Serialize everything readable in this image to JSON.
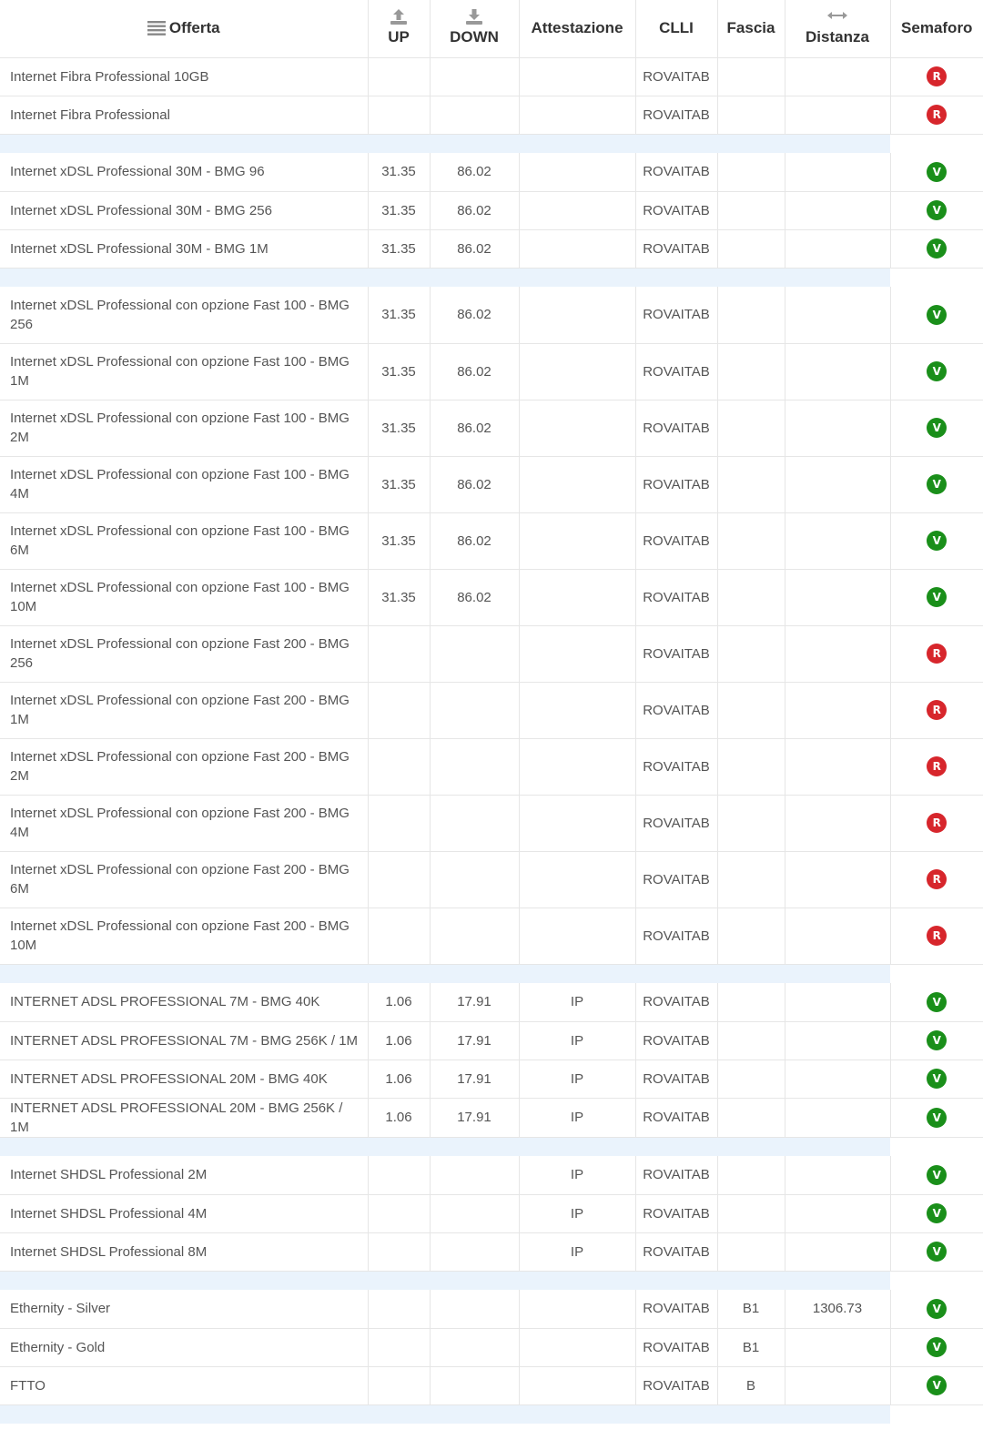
{
  "header": {
    "offerta": "Offerta",
    "up": "UP",
    "down": "DOWN",
    "attestazione": "Attestazione",
    "clli": "CLLI",
    "fascia": "Fascia",
    "distanza": "Distanza",
    "semaforo": "Semaforo",
    "icons": {
      "offerta": "list-icon",
      "up": "upload-icon",
      "down": "download-icon",
      "distanza": "horizontal-arrows-icon"
    }
  },
  "colors": {
    "red": "#d7262c",
    "green": "#1a8f1a",
    "separator": "#eaf3fc",
    "border": "#e6e6e6"
  },
  "rows": [
    {
      "offerta": "Internet Fibra Professional 10GB",
      "up": "",
      "down": "",
      "attestazione": "",
      "clli": "ROVAITAB",
      "fascia": "",
      "distanza": "",
      "semaforo": "R"
    },
    {
      "offerta": "Internet Fibra Professional",
      "up": "",
      "down": "",
      "attestazione": "",
      "clli": "ROVAITAB",
      "fascia": "",
      "distanza": "",
      "semaforo": "R"
    },
    {
      "offerta": "Internet xDSL Professional 30M - BMG 96",
      "up": "31.35",
      "down": "86.02",
      "attestazione": "",
      "clli": "ROVAITAB",
      "fascia": "",
      "distanza": "",
      "semaforo": "V"
    },
    {
      "offerta": "Internet xDSL Professional 30M - BMG 256",
      "up": "31.35",
      "down": "86.02",
      "attestazione": "",
      "clli": "ROVAITAB",
      "fascia": "",
      "distanza": "",
      "semaforo": "V"
    },
    {
      "offerta": "Internet xDSL Professional 30M - BMG 1M",
      "up": "31.35",
      "down": "86.02",
      "attestazione": "",
      "clli": "ROVAITAB",
      "fascia": "",
      "distanza": "",
      "semaforo": "V"
    },
    {
      "offerta": "Internet xDSL Professional con opzione Fast 100 - BMG 256",
      "up": "31.35",
      "down": "86.02",
      "attestazione": "",
      "clli": "ROVAITAB",
      "fascia": "",
      "distanza": "",
      "semaforo": "V"
    },
    {
      "offerta": "Internet xDSL Professional con opzione Fast 100 - BMG 1M",
      "up": "31.35",
      "down": "86.02",
      "attestazione": "",
      "clli": "ROVAITAB",
      "fascia": "",
      "distanza": "",
      "semaforo": "V"
    },
    {
      "offerta": "Internet xDSL Professional con opzione Fast 100 - BMG 2M",
      "up": "31.35",
      "down": "86.02",
      "attestazione": "",
      "clli": "ROVAITAB",
      "fascia": "",
      "distanza": "",
      "semaforo": "V"
    },
    {
      "offerta": "Internet xDSL Professional con opzione Fast 100 - BMG 4M",
      "up": "31.35",
      "down": "86.02",
      "attestazione": "",
      "clli": "ROVAITAB",
      "fascia": "",
      "distanza": "",
      "semaforo": "V"
    },
    {
      "offerta": "Internet xDSL Professional con opzione Fast 100 - BMG 6M",
      "up": "31.35",
      "down": "86.02",
      "attestazione": "",
      "clli": "ROVAITAB",
      "fascia": "",
      "distanza": "",
      "semaforo": "V"
    },
    {
      "offerta": "Internet xDSL Professional con opzione Fast 100 - BMG 10M",
      "up": "31.35",
      "down": "86.02",
      "attestazione": "",
      "clli": "ROVAITAB",
      "fascia": "",
      "distanza": "",
      "semaforo": "V"
    },
    {
      "offerta": "Internet xDSL Professional con opzione Fast 200 - BMG 256",
      "up": "",
      "down": "",
      "attestazione": "",
      "clli": "ROVAITAB",
      "fascia": "",
      "distanza": "",
      "semaforo": "R"
    },
    {
      "offerta": "Internet xDSL Professional con opzione Fast 200 - BMG 1M",
      "up": "",
      "down": "",
      "attestazione": "",
      "clli": "ROVAITAB",
      "fascia": "",
      "distanza": "",
      "semaforo": "R"
    },
    {
      "offerta": "Internet xDSL Professional con opzione Fast 200 - BMG 2M",
      "up": "",
      "down": "",
      "attestazione": "",
      "clli": "ROVAITAB",
      "fascia": "",
      "distanza": "",
      "semaforo": "R"
    },
    {
      "offerta": "Internet xDSL Professional con opzione Fast 200 - BMG 4M",
      "up": "",
      "down": "",
      "attestazione": "",
      "clli": "ROVAITAB",
      "fascia": "",
      "distanza": "",
      "semaforo": "R"
    },
    {
      "offerta": "Internet xDSL Professional con opzione Fast 200 - BMG 6M",
      "up": "",
      "down": "",
      "attestazione": "",
      "clli": "ROVAITAB",
      "fascia": "",
      "distanza": "",
      "semaforo": "R"
    },
    {
      "offerta": "Internet xDSL Professional con opzione Fast 200 - BMG 10M",
      "up": "",
      "down": "",
      "attestazione": "",
      "clli": "ROVAITAB",
      "fascia": "",
      "distanza": "",
      "semaforo": "R"
    },
    {
      "offerta": "INTERNET ADSL PROFESSIONAL 7M - BMG 40K",
      "up": "1.06",
      "down": "17.91",
      "attestazione": "IP",
      "clli": "ROVAITAB",
      "fascia": "",
      "distanza": "",
      "semaforo": "V"
    },
    {
      "offerta": "INTERNET ADSL PROFESSIONAL 7M - BMG 256K / 1M",
      "up": "1.06",
      "down": "17.91",
      "attestazione": "IP",
      "clli": "ROVAITAB",
      "fascia": "",
      "distanza": "",
      "semaforo": "V"
    },
    {
      "offerta": "INTERNET ADSL PROFESSIONAL 20M - BMG 40K",
      "up": "1.06",
      "down": "17.91",
      "attestazione": "IP",
      "clli": "ROVAITAB",
      "fascia": "",
      "distanza": "",
      "semaforo": "V"
    },
    {
      "offerta": "INTERNET ADSL PROFESSIONAL 20M - BMG 256K / 1M",
      "up": "1.06",
      "down": "17.91",
      "attestazione": "IP",
      "clli": "ROVAITAB",
      "fascia": "",
      "distanza": "",
      "semaforo": "V"
    },
    {
      "offerta": "Internet SHDSL Professional 2M",
      "up": "",
      "down": "",
      "attestazione": "IP",
      "clli": "ROVAITAB",
      "fascia": "",
      "distanza": "",
      "semaforo": "V"
    },
    {
      "offerta": "Internet SHDSL Professional 4M",
      "up": "",
      "down": "",
      "attestazione": "IP",
      "clli": "ROVAITAB",
      "fascia": "",
      "distanza": "",
      "semaforo": "V"
    },
    {
      "offerta": "Internet SHDSL Professional 8M",
      "up": "",
      "down": "",
      "attestazione": "IP",
      "clli": "ROVAITAB",
      "fascia": "",
      "distanza": "",
      "semaforo": "V"
    },
    {
      "offerta": "Ethernity - Silver",
      "up": "",
      "down": "",
      "attestazione": "",
      "clli": "ROVAITAB",
      "fascia": "B1",
      "distanza": "1306.73",
      "semaforo": "V"
    },
    {
      "offerta": "Ethernity - Gold",
      "up": "",
      "down": "",
      "attestazione": "",
      "clli": "ROVAITAB",
      "fascia": "B1",
      "distanza": "",
      "semaforo": "V"
    },
    {
      "offerta": "FTTO",
      "up": "",
      "down": "",
      "attestazione": "",
      "clli": "ROVAITAB",
      "fascia": "B",
      "distanza": "",
      "semaforo": "V"
    }
  ]
}
